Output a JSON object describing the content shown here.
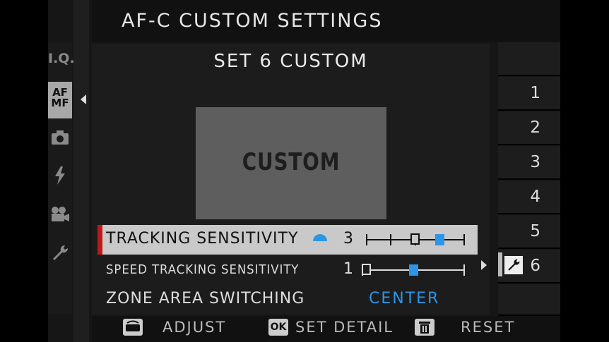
{
  "header": {
    "title": "AF-C CUSTOM SETTINGS"
  },
  "sidebar": {
    "items": [
      {
        "label": "I.Q."
      },
      {
        "label": "AF\nMF",
        "selected": true
      },
      {
        "icon": "camera-icon"
      },
      {
        "icon": "flash-icon"
      },
      {
        "icon": "movie-camera-icon"
      },
      {
        "icon": "wrench-icon"
      }
    ]
  },
  "panel": {
    "subtitle": "SET 6 CUSTOM",
    "preview_label": "CUSTOM"
  },
  "settings": [
    {
      "label": "TRACKING SENSITIVITY",
      "value": "3",
      "slider_original": 3,
      "slider_current": 4,
      "slider_max": 5
    },
    {
      "label": "SPEED TRACKING SENSITIVITY",
      "value": "1",
      "slider_original": 1,
      "slider_current": 2,
      "slider_max": 3
    },
    {
      "label": "ZONE AREA SWITCHING",
      "value": "CENTER"
    }
  ],
  "sets": [
    "1",
    "2",
    "3",
    "4",
    "5",
    "6"
  ],
  "active_set": "6",
  "footer": {
    "adjust": "ADJUST",
    "ok_icon": "OK",
    "set_detail": "SET DETAIL",
    "reset": "RESET"
  },
  "colors": {
    "accent": "#2b95e6",
    "highlight_bar": "#c01818"
  }
}
